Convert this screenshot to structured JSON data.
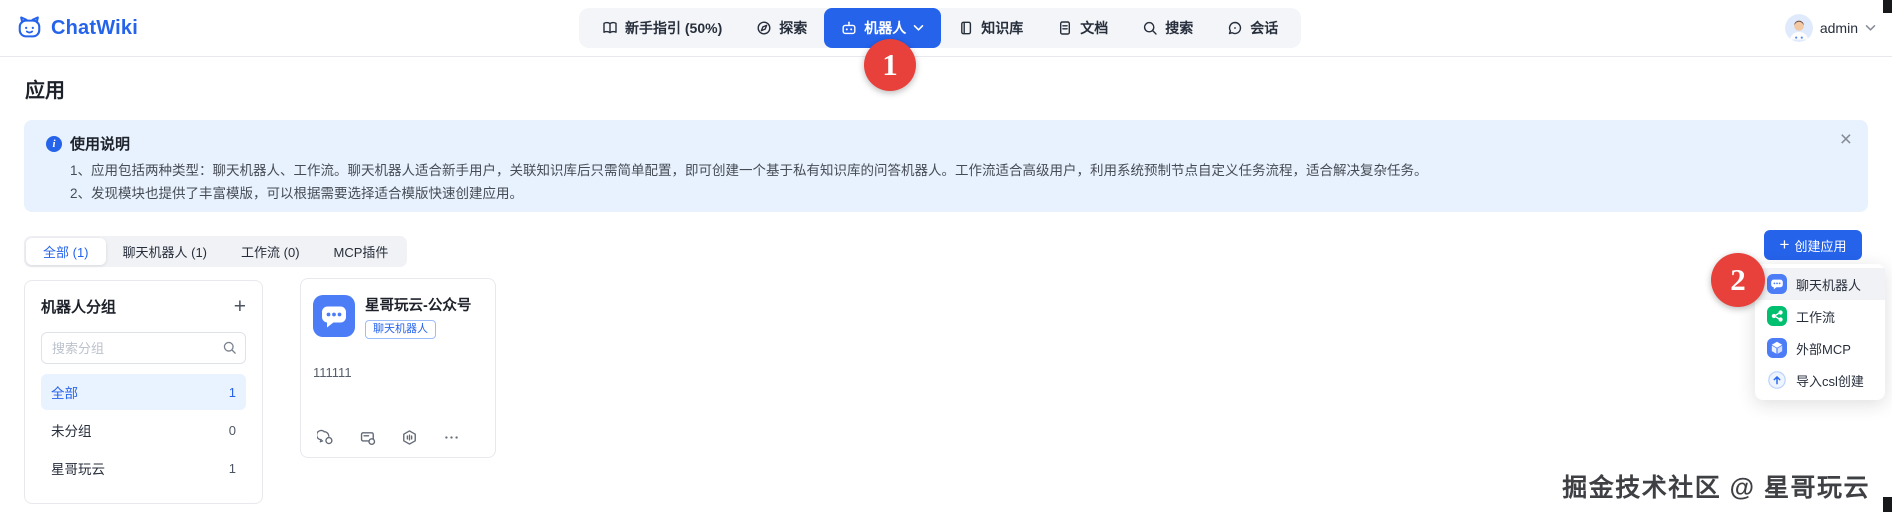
{
  "navbar": {
    "logo_text": "ChatWiki",
    "items": [
      {
        "label": "新手指引 (50%)"
      },
      {
        "label": "探索"
      },
      {
        "label": "机器人",
        "active": true
      },
      {
        "label": "知识库"
      },
      {
        "label": "文档"
      },
      {
        "label": "搜索"
      },
      {
        "label": "会话"
      }
    ],
    "user": {
      "name": "admin"
    }
  },
  "page": {
    "title": "应用"
  },
  "notice": {
    "title": "使用说明",
    "line1": "1、应用包括两种类型：聊天机器人、工作流。聊天机器人适合新手用户，关联知识库后只需简单配置，即可创建一个基于私有知识库的问答机器人。工作流适合高级用户，利用系统预制节点自定义任务流程，适合解决复杂任务。",
    "line2": "2、发现模块也提供了丰富模版，可以根据需要选择适合模版快速创建应用。"
  },
  "tabs": [
    {
      "label": "全部 (1)",
      "active": true
    },
    {
      "label": "聊天机器人 (1)"
    },
    {
      "label": "工作流 (0)"
    },
    {
      "label": "MCP插件"
    }
  ],
  "create_app": {
    "button_label": "创建应用",
    "menu": [
      {
        "label": "聊天机器人",
        "icon": "chatbot-icon"
      },
      {
        "label": "工作流",
        "icon": "workflow-icon"
      },
      {
        "label": "外部MCP",
        "icon": "mcp-cube-icon"
      },
      {
        "label": "导入csl创建",
        "icon": "import-upload-icon"
      }
    ]
  },
  "groups_panel": {
    "title": "机器人分组",
    "search_placeholder": "搜索分组",
    "items": [
      {
        "name": "全部",
        "count": "1",
        "active": true
      },
      {
        "name": "未分组",
        "count": "0"
      },
      {
        "name": "星哥玩云",
        "count": "1"
      }
    ]
  },
  "app_card": {
    "title": "星哥玩云-公众号",
    "tag": "聊天机器人",
    "description": "111111"
  },
  "annotations": {
    "step1": "1",
    "step2": "2"
  },
  "watermark": "掘金技术社区 @ 星哥玩云",
  "colors": {
    "primary": "#2563eb",
    "annotation_red": "#e8413c",
    "workflow_green": "#00bf6f",
    "notice_bg": "#e8f2fe"
  }
}
